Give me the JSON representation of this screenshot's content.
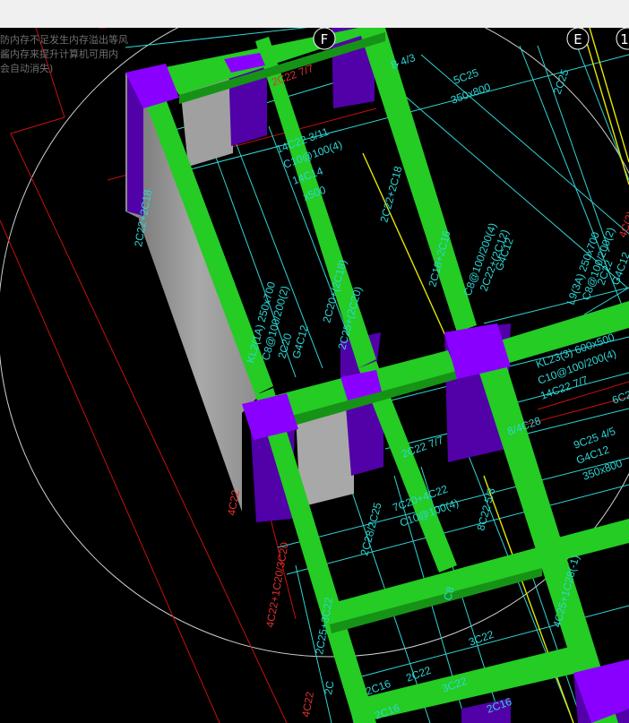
{
  "window": {
    "toolbar_title": ""
  },
  "notice": {
    "line1": "防内存不足发生内存溢出等风",
    "line2": "酱内存来提升计算机可用内",
    "line3": "会自动消失)"
  },
  "axes": {
    "F": "F",
    "E": "E",
    "one": "1"
  },
  "colors": {
    "beam": "#22cc22",
    "column": "#7a00e6",
    "wall": "#9a9a9a",
    "annotation": "#33dddd",
    "axis_red": "#d41010",
    "background": "#000000",
    "toolbar": "#f0f0f0"
  },
  "labels": {
    "l01": "2C22 7/7",
    "l02": "B 4/3",
    "l03": "5C25",
    "l04": "350x800",
    "l05": "2C25",
    "l06": "2C22+2C18",
    "l07": "14C22 3/11",
    "l08": "C10@100(4)",
    "l09": "14C14",
    "l10": "x500",
    "l11": "2C22+2C18",
    "l12": "2C18+2C16",
    "l13": "C8@100/200(4)",
    "l14": "2C22+(2C12)",
    "l15": "G4C12",
    "l16": "L9(3A) 250x700",
    "l17": "C8@100/200(2)",
    "l18": "2C22",
    "l19": "G4C12",
    "l20": "2C25+(2C20)",
    "l21": "KL2(1A) 250x700",
    "l22": "C8@100/200(2)",
    "l23": "2C20",
    "l24": "G4C12",
    "l25": "2C20+(2C18)",
    "l26": "KL23(3) 600x500",
    "l27": "C10@100/200(4)",
    "l28": "14C22 7/7",
    "l29": "6C2",
    "l30": "8/4C28",
    "l31": "9C25 4/5",
    "l32": "G4C12",
    "l33": "350x800",
    "l34": "2C22 7/7",
    "l35": "7C20+4C22",
    "l36": "C10@100(4)",
    "l37": "8C22 5/3",
    "l38": "2C28/2C25",
    "l39": "4C22",
    "l40": "4C22+1C20/3C20",
    "l41": "4C25+1C28(-1)",
    "l42": "C8",
    "l43": "3C22",
    "l44": "2C25+3C22",
    "l45": "2C22",
    "l46": "3C22",
    "l47": "2C16",
    "l48": "2C16",
    "l49": "2C16",
    "l50": "2C",
    "l51": "4C22",
    "l52": "4C(2)"
  }
}
